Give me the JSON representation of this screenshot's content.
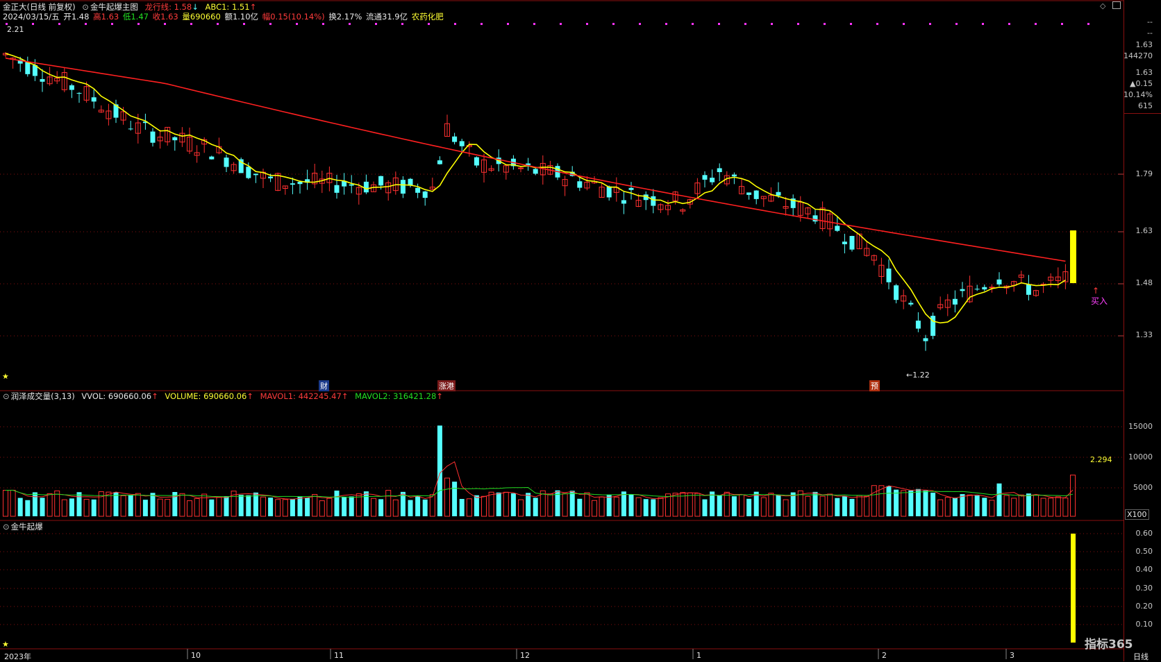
{
  "header": {
    "stock_name": "金正大",
    "mode": "(日线 前复权)",
    "indicator": "金牛起爆主图",
    "dragon_label": "龙行线: 1.58",
    "abc_label": "ABC1: 1.51",
    "date": "2024/03/15/五",
    "open": "开1.48",
    "high": "高1.63",
    "low": "低1.47",
    "close": "收1.63",
    "volume": "量690660",
    "amount": "额1.10亿",
    "change": "幅0.15(10.14%)",
    "turnover": "换2.17%",
    "float": "流通31.9亿",
    "sector": "农药化肥"
  },
  "right_panel": {
    "dash1": "--",
    "dash2": "--",
    "price": "1.63",
    "vol": "144270",
    "price2": "1.63",
    "chg": "▲0.15",
    "pct": "10.14%",
    "count": "615"
  },
  "price_axis": [
    "1.79",
    "1.63",
    "1.48",
    "1.33"
  ],
  "price_annotations": {
    "high_mark": "2.21",
    "low_mark": "←1.22",
    "buy": "买入",
    "ev1": "财",
    "ev2": "涨港",
    "ev3": "预"
  },
  "volume_header": {
    "name": "润泽成交量(3,13)",
    "vvol": "VVOL: 690660.06",
    "volume": "VOLUME: 690660.06",
    "mavol1": "MAVOL1: 442245.47",
    "mavol2": "MAVOL2: 316421.28"
  },
  "volume_axis": [
    "15000",
    "10000",
    "5000"
  ],
  "volume_note": "2.294",
  "volume_unit": "X100",
  "sub_header": "金牛起爆",
  "sub_axis": [
    "0.60",
    "0.50",
    "0.40",
    "0.30",
    "0.20",
    "0.10"
  ],
  "date_axis": {
    "year": "2023年",
    "months": [
      "10",
      "11",
      "12",
      "1",
      "2",
      "3"
    ]
  },
  "period": "日线",
  "watermark": "指标365",
  "colors": {
    "up": "#ff3030",
    "down": "#55ffff",
    "ma_short": "#ffff00",
    "ma_long": "#ff2020",
    "grid": "#8a1010"
  }
}
